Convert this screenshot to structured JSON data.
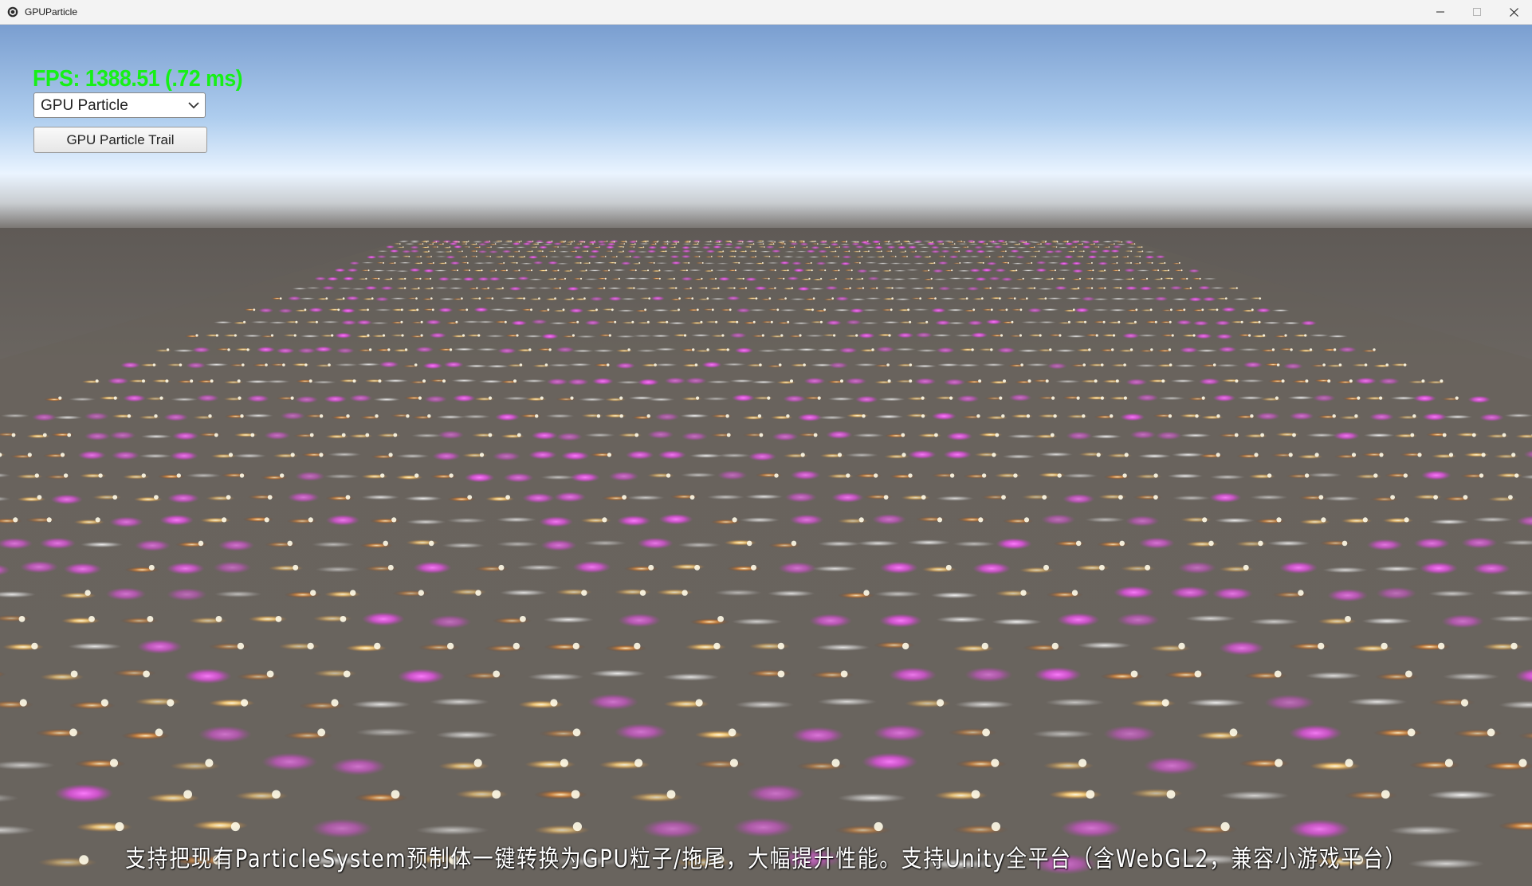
{
  "window": {
    "title": "GPUParticle",
    "controls": {
      "minimize_icon": "minimize-icon",
      "maximize_icon": "maximize-icon",
      "close_icon": "close-icon"
    }
  },
  "overlay": {
    "fps_text": "FPS: 1388.51 (.72 ms)",
    "fps_color": "#16f016",
    "mode_dropdown": {
      "selected": "GPU Particle",
      "icon": "chevron-down-icon"
    },
    "trail_button_label": "GPU Particle Trail"
  },
  "scene": {
    "sky_top": "#7b9fd0",
    "sky_horizon": "#eef6ff",
    "ground": "#6b6661",
    "particle_colors": [
      "#ff52ff",
      "#ffd780",
      "#e8e8e8",
      "#ffb050"
    ]
  },
  "caption": "支持把现有ParticleSystem预制体一键转换为GPU粒子/拖尾，大幅提升性能。支持Unity全平台（含WebGL2，兼容小游戏平台）"
}
